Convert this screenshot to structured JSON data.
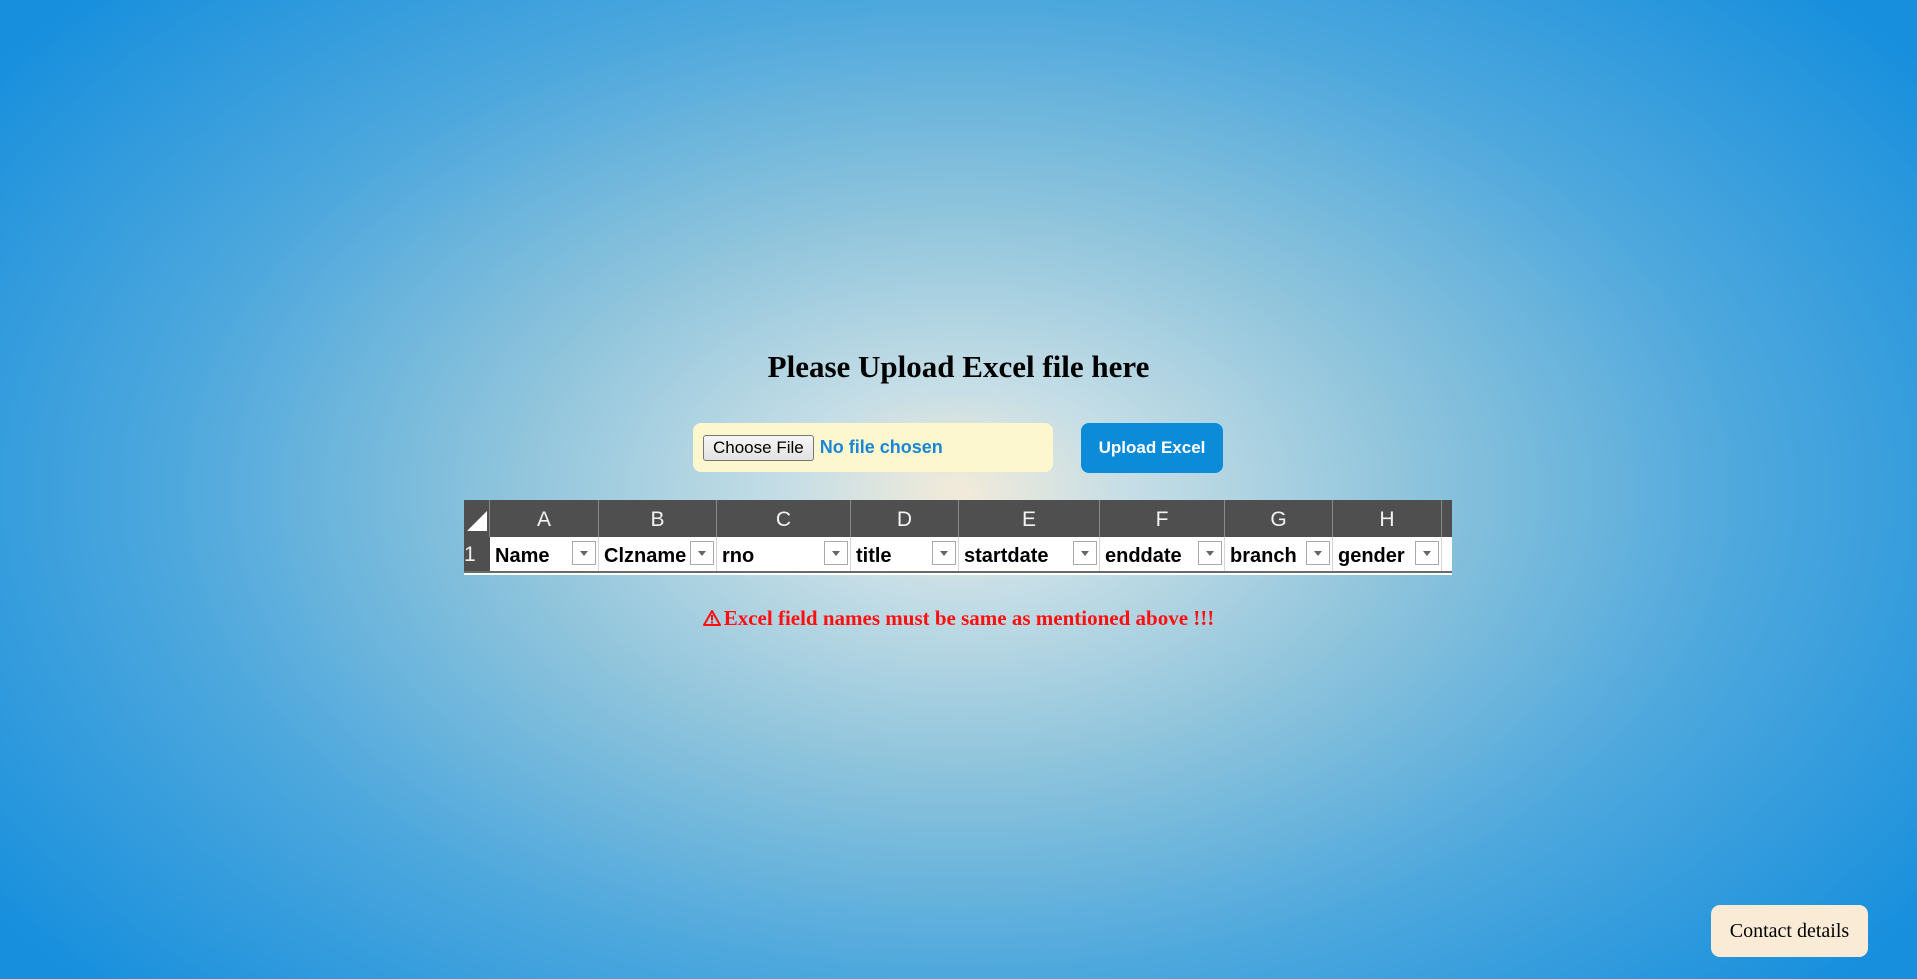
{
  "heading": "Please Upload Excel file here",
  "file_input": {
    "button_label": "Choose File",
    "status_text": "No file chosen"
  },
  "upload_button_label": "Upload Excel",
  "excel_header": {
    "columns": [
      "A",
      "B",
      "C",
      "D",
      "E",
      "F",
      "G",
      "H"
    ],
    "row_number": "1",
    "fields": [
      "Name",
      "Clzname",
      "rno",
      "title",
      "startdate",
      "enddate",
      "branch",
      "gender"
    ]
  },
  "warning": {
    "icon": "warning-triangle-icon",
    "text": "Excel field names must be same as mentioned above !!!"
  },
  "contact_button_label": "Contact details",
  "colors": {
    "upload_button": "#0b8bd8",
    "warning_text": "#ff0f0f",
    "file_box": "#fdf7cf",
    "contact_button": "#faebd7"
  }
}
